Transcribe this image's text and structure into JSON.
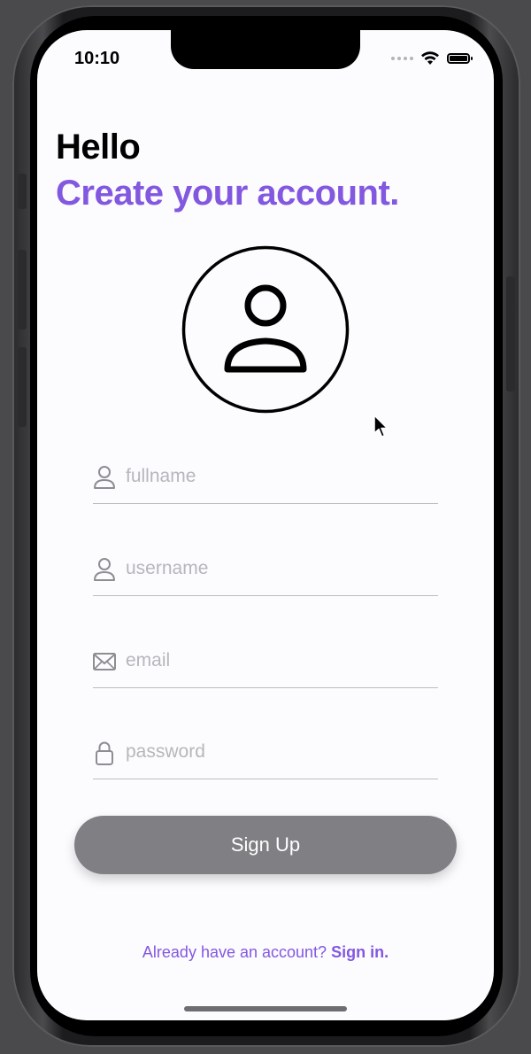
{
  "status_bar": {
    "time": "10:10"
  },
  "header": {
    "greeting": "Hello",
    "headline": "Create your account."
  },
  "form": {
    "fields": [
      {
        "placeholder": "fullname",
        "icon": "person-icon"
      },
      {
        "placeholder": "username",
        "icon": "person-icon"
      },
      {
        "placeholder": "email",
        "icon": "envelope-icon"
      },
      {
        "placeholder": "password",
        "icon": "lock-icon"
      }
    ],
    "submit_label": "Sign Up"
  },
  "footer": {
    "prompt": "Already have an account?",
    "link": "Sign in."
  },
  "colors": {
    "accent": "#8358e0",
    "button": "#807f84",
    "background": "#fcfbfe"
  }
}
